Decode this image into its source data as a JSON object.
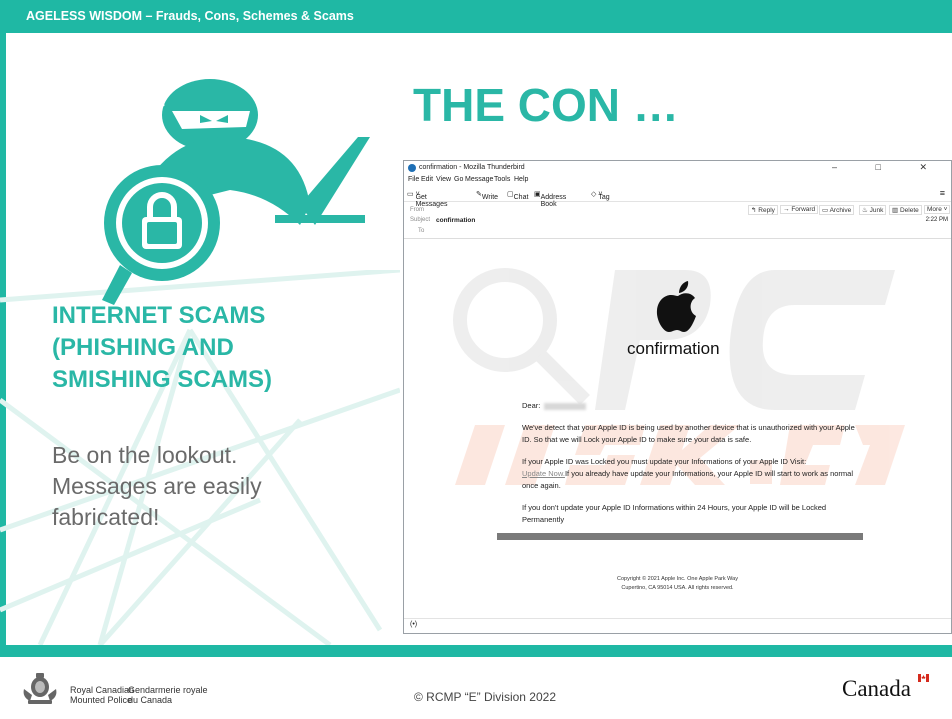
{
  "header": {
    "title": "AGELESS WISDOM – Frauds, Cons, Schemes & Scams"
  },
  "slide": {
    "title": "THE CON …",
    "subtitle_lines": [
      "INTERNET SCAMS",
      "(PHISHING AND",
      "SMISHING SCAMS)"
    ],
    "body_lines": [
      "Be on the lookout.",
      "Messages are easily",
      "fabricated!"
    ]
  },
  "hero_icon": "hacker-laptop-lock-icon",
  "email_window": {
    "title": "confirmation - Mozilla Thunderbird",
    "window_controls": [
      "–",
      "□",
      "✕"
    ],
    "menu": [
      "File",
      "Edit",
      "View",
      "Go",
      "Message",
      "Tools",
      "Help"
    ],
    "toolbar": [
      "Get Messages",
      "Write",
      "Chat",
      "Address Book",
      "Tag"
    ],
    "header_labels": {
      "from": "From",
      "subject": "Subject",
      "to": "To"
    },
    "subject": "confirmation",
    "actions": [
      "Reply",
      "Forward",
      "Archive",
      "Junk",
      "Delete",
      "More"
    ],
    "time": "2:22 PM",
    "message": {
      "heading": "confirmation",
      "dear": "Dear:",
      "paragraph1": "We've detect that your Apple ID is being used by another device that is unauthorized with your Apple ID. So that we will Lock your Apple ID to make sure your data is safe.",
      "paragraph2_before": "If your Apple ID was Locked you must update your Informations of your Apple ID Visit:",
      "paragraph2_link": "Update Now.",
      "paragraph2_after": "If you already have update your Informations, your Apple ID will start to work as normal once again.",
      "paragraph3": "If you don't update your Apple ID Informations within 24 Hours, your Apple ID will be Locked Permanently",
      "footer_line1": "Copyright © 2021 Apple Inc. One Apple Park Way",
      "footer_line2": "Cupertino, CA 95014 USA. All rights reserved."
    },
    "status_icon": "(•)"
  },
  "footer": {
    "rcmp_en_1": "Royal Canadian",
    "rcmp_en_2": "Mounted Police",
    "rcmp_fr_1": "Gendarmerie royale",
    "rcmp_fr_2": "du Canada",
    "copyright": "© RCMP “E” Division 2022",
    "wordmark": "Canada"
  },
  "colors": {
    "teal": "#1fb8a4",
    "title_teal": "#2ab7a6",
    "body_gray": "#6a6a6a"
  }
}
